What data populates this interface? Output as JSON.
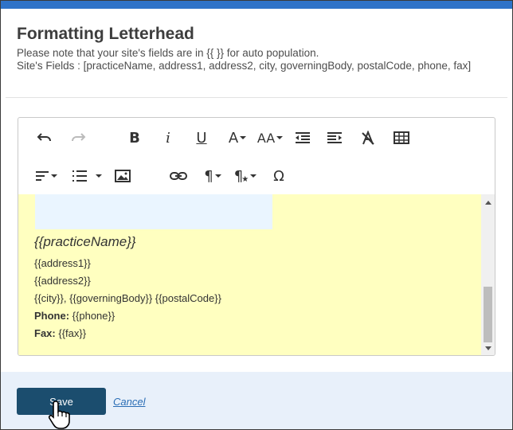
{
  "dialog": {
    "title": "Formatting Letterhead",
    "note": "Please note that your site's fields are in {{ }} for auto population.",
    "fields_label": "Site's Fields : [practiceName, address1, address2, city, governingBody, postalCode, phone, fax]"
  },
  "toolbar": {
    "row1": [
      "undo-icon",
      "redo-icon",
      "bold-icon",
      "italic-icon",
      "underline-icon",
      "font-color-icon",
      "font-size-icon",
      "outdent-icon",
      "indent-icon",
      "clear-format-icon",
      "table-icon"
    ],
    "row2": [
      "align-icon",
      "list-icon",
      "image-icon",
      "link-icon",
      "paragraph-icon",
      "paragraph-style-icon",
      "special-char-icon"
    ],
    "bold": "B",
    "italic": "i",
    "underline": "U",
    "font_color": "A",
    "font_size": "AA",
    "paragraph": "¶",
    "omega": "Ω"
  },
  "content": {
    "practice_name": "{{practiceName}}",
    "address1": "{{address1}}",
    "address2": "{{address2}}",
    "city_line": "{{city}}, {{governingBody}} {{postalCode}}",
    "phone_label": "Phone:",
    "phone_value": " {{phone}}",
    "fax_label": "Fax:",
    "fax_value": " {{fax}}"
  },
  "footer": {
    "save_label": "Save",
    "cancel_label": "Cancel"
  },
  "colors": {
    "accent_bar": "#2f73c8",
    "save_button": "#1b4d6e",
    "editor_bg": "#ffffc0",
    "footer_bg": "#e8f0fa"
  }
}
